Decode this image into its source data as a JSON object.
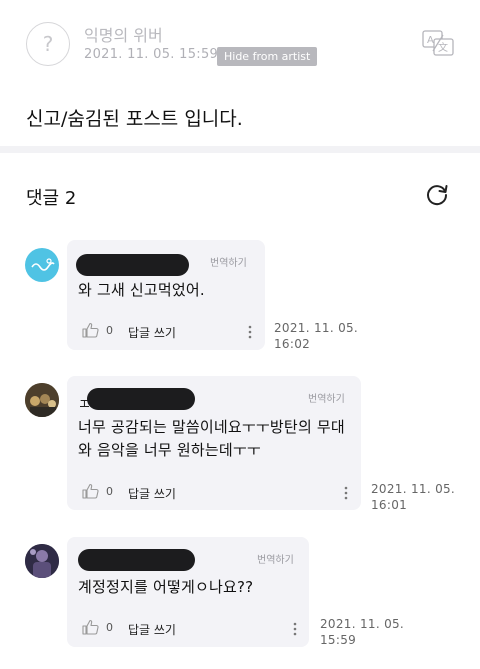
{
  "post": {
    "author_name": "익명의 위버",
    "date": "2021. 11. 05. 15:59",
    "hide_badge": "Hide from artist",
    "text": "신고/숨김된 포스트 입니다."
  },
  "comments_section": {
    "title": "댓글 2"
  },
  "comments": [
    {
      "name_prefix": "",
      "translate_label": "번역하기",
      "text": "와 그새 신고먹었어.",
      "like_count": "0",
      "reply_label": "답글 쓰기",
      "date_line1": "2021. 11. 05.",
      "date_line2": "16:02"
    },
    {
      "name_prefix": "ェ",
      "translate_label": "번역하기",
      "text": "너무 공감되는 말씀이네요ㅜㅜ방탄의 무대와 음악을 너무 원하는데ㅜㅜ",
      "like_count": "0",
      "reply_label": "답글 쓰기",
      "date_line1": "2021. 11. 05.",
      "date_line2": "16:01"
    },
    {
      "name_prefix": "",
      "translate_label": "번역하기",
      "text": "계정정지를 어떻게ㅇ나요??",
      "like_count": "0",
      "reply_label": "답글 쓰기",
      "date_line1": "2021. 11. 05.",
      "date_line2": "15:59"
    }
  ],
  "colors": {
    "badge_bg": "#b8b8bd",
    "bubble_bg": "#f3f3f7",
    "divider": "#f2f2f5"
  },
  "icons": [
    "question-mark-icon",
    "translate-icon",
    "refresh-icon",
    "thumbs-up-icon",
    "more-vertical-icon"
  ]
}
